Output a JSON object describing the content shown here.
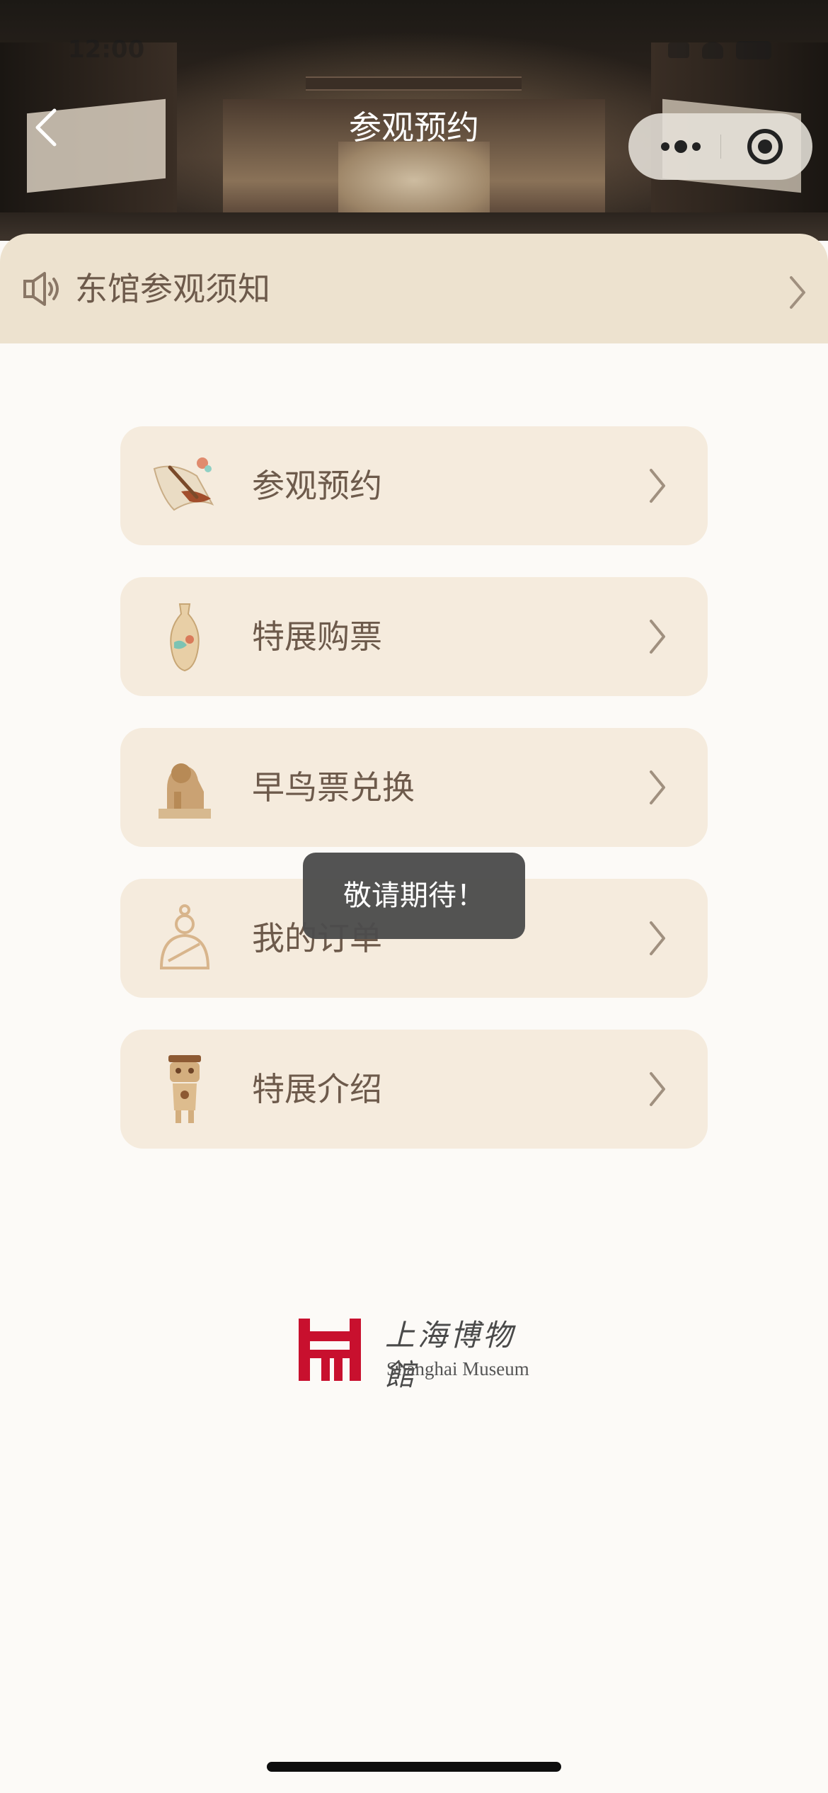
{
  "colors": {
    "background": "#fcfaf7",
    "notice_bg": "#ede2cf",
    "card_bg": "#f5ebdd",
    "text_brown": "#6d5a4b",
    "toast_bg": "#4c4c4c",
    "logo_red": "#c8102e"
  },
  "status_bar": {
    "time": "12:00"
  },
  "nav": {
    "back_icon": "chevron-left-icon",
    "title": "参观预约",
    "capsule_more_icon": "more-dots-icon",
    "capsule_close_icon": "target-close-icon"
  },
  "notice": {
    "icon": "speaker-icon",
    "label": "东馆参观须知",
    "arrow_icon": "chevron-right-icon"
  },
  "menu": [
    {
      "label": "参观预约",
      "icon": "scroll-brush-icon"
    },
    {
      "label": "特展购票",
      "icon": "vase-icon"
    },
    {
      "label": "早鸟票兑换",
      "icon": "lion-statue-icon"
    },
    {
      "label": "我的订单",
      "icon": "figure-icon"
    },
    {
      "label": "特展介绍",
      "icon": "pottery-figure-icon"
    }
  ],
  "toast": {
    "message": "敬请期待！"
  },
  "logo": {
    "chinese": "上海博物館",
    "english": "Shanghai Museum"
  }
}
